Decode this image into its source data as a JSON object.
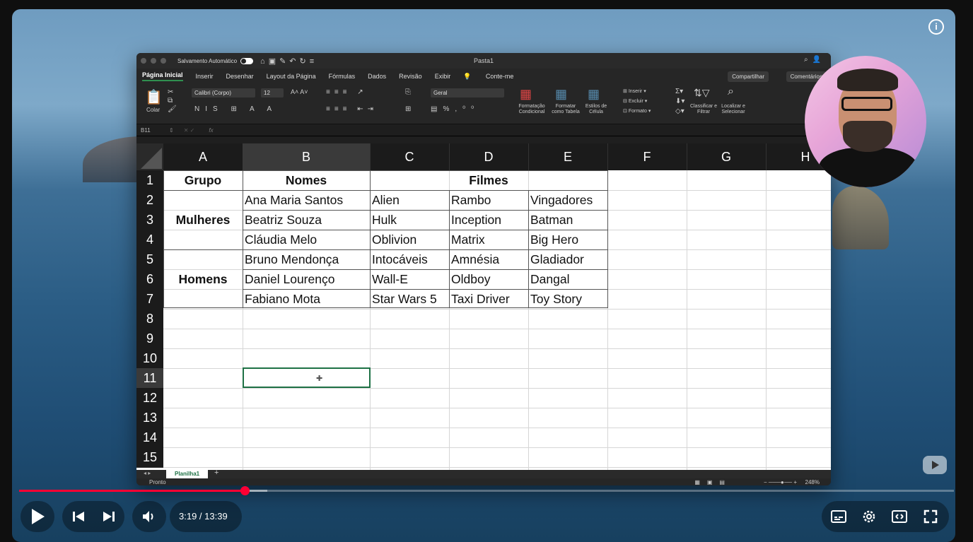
{
  "excel": {
    "title": "Pasta1",
    "autosave_label": "Salvamento Automático",
    "menu": [
      "Página Inicial",
      "Inserir",
      "Desenhar",
      "Layout da Página",
      "Fórmulas",
      "Dados",
      "Revisão",
      "Exibir",
      "Conte-me"
    ],
    "share_label": "Compartilhar",
    "comments_label": "Comentários",
    "ribbon": {
      "paste": "Colar",
      "font": "Calibri (Corpo)",
      "size": "12",
      "number_format": "Geral",
      "cond_format": "Formatação Condicional",
      "format_table": "Formatar como Tabela",
      "cell_styles": "Estilos de Célula",
      "insert": "Inserir",
      "delete": "Excluir",
      "format": "Formato",
      "sort_filter": "Classificar e Filtrar",
      "find_select": "Localizar e Selecionar"
    },
    "name_box": "B11",
    "fx": "fx",
    "columns": [
      "A",
      "B",
      "C",
      "D",
      "E",
      "F",
      "G",
      "H"
    ],
    "rows": [
      "1",
      "2",
      "3",
      "4",
      "5",
      "6",
      "7",
      "8",
      "9",
      "10",
      "11",
      "12",
      "13",
      "14",
      "15"
    ],
    "cells": {
      "A1": "Grupo",
      "B1": "Nomes",
      "C1": "Filmes",
      "A3": "Mulheres",
      "A6": "Homens",
      "B2": "Ana Maria Santos",
      "C2": "Alien",
      "D2": "Rambo",
      "E2": "Vingadores",
      "B3": "Beatriz Souza",
      "C3": "Hulk",
      "D3": "Inception",
      "E3": "Batman",
      "B4": "Cláudia Melo",
      "C4": "Oblivion",
      "D4": "Matrix",
      "E4": "Big Hero",
      "B5": "Bruno Mendonça",
      "C5": "Intocáveis",
      "D5": "Amnésia",
      "E5": "Gladiador",
      "B6": "Daniel Lourenço",
      "C6": "Wall-E",
      "D6": "Oldboy",
      "E6": "Dangal",
      "B7": "Fabiano Mota",
      "C7": "Star Wars 5",
      "D7": "Taxi Driver",
      "E7": "Toy Story"
    },
    "sheet_tab": "Planilha1",
    "status": "Pronto",
    "zoom": "248%"
  },
  "player": {
    "time": "3:19 / 13:39",
    "progress": 0.241,
    "accent": "#ff0033"
  },
  "icons": [
    "info-icon",
    "play-icon",
    "previous-icon",
    "next-icon",
    "volume-icon",
    "subtitles-icon",
    "settings-icon",
    "miniplayer-icon",
    "fullscreen-icon"
  ]
}
